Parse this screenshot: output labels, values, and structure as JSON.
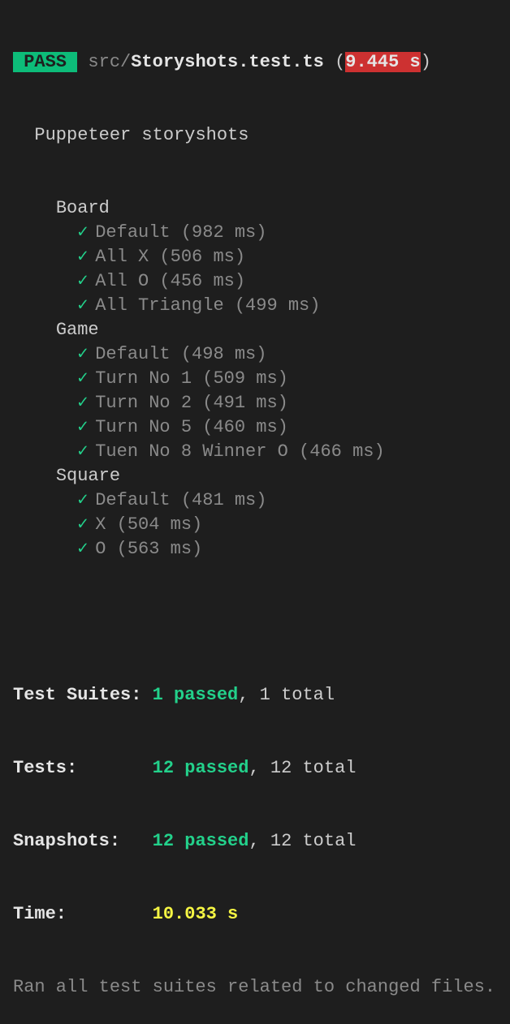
{
  "header": {
    "status": "PASS",
    "path_prefix": "src/",
    "file": "Storyshots.test.ts",
    "open_paren": "(",
    "duration": "9.445 s",
    "close_paren": ")"
  },
  "suite": "Puppeteer storyshots",
  "groups": [
    {
      "name": "Board",
      "tests": [
        "Default (982 ms)",
        "All X (506 ms)",
        "All O (456 ms)",
        "All Triangle (499 ms)"
      ]
    },
    {
      "name": "Game",
      "tests": [
        "Default (498 ms)",
        "Turn No 1 (509 ms)",
        "Turn No 2 (491 ms)",
        "Turn No 5 (460 ms)",
        "Tuen No 8 Winner O (466 ms)"
      ]
    },
    {
      "name": "Square",
      "tests": [
        "Default (481 ms)",
        "X (504 ms)",
        "O (563 ms)"
      ]
    }
  ],
  "check_icon": "✓",
  "summary": {
    "suites_label": "Test Suites: ",
    "suites_passed": "1 passed",
    "suites_total": ", 1 total",
    "tests_label": "Tests:       ",
    "tests_passed": "12 passed",
    "tests_total": ", 12 total",
    "snap_label": "Snapshots:   ",
    "snap_passed": "12 passed",
    "snap_total": ", 12 total",
    "time_label": "Time:        ",
    "time_value": "10.033 s",
    "footer": "Ran all test suites related to changed files."
  }
}
